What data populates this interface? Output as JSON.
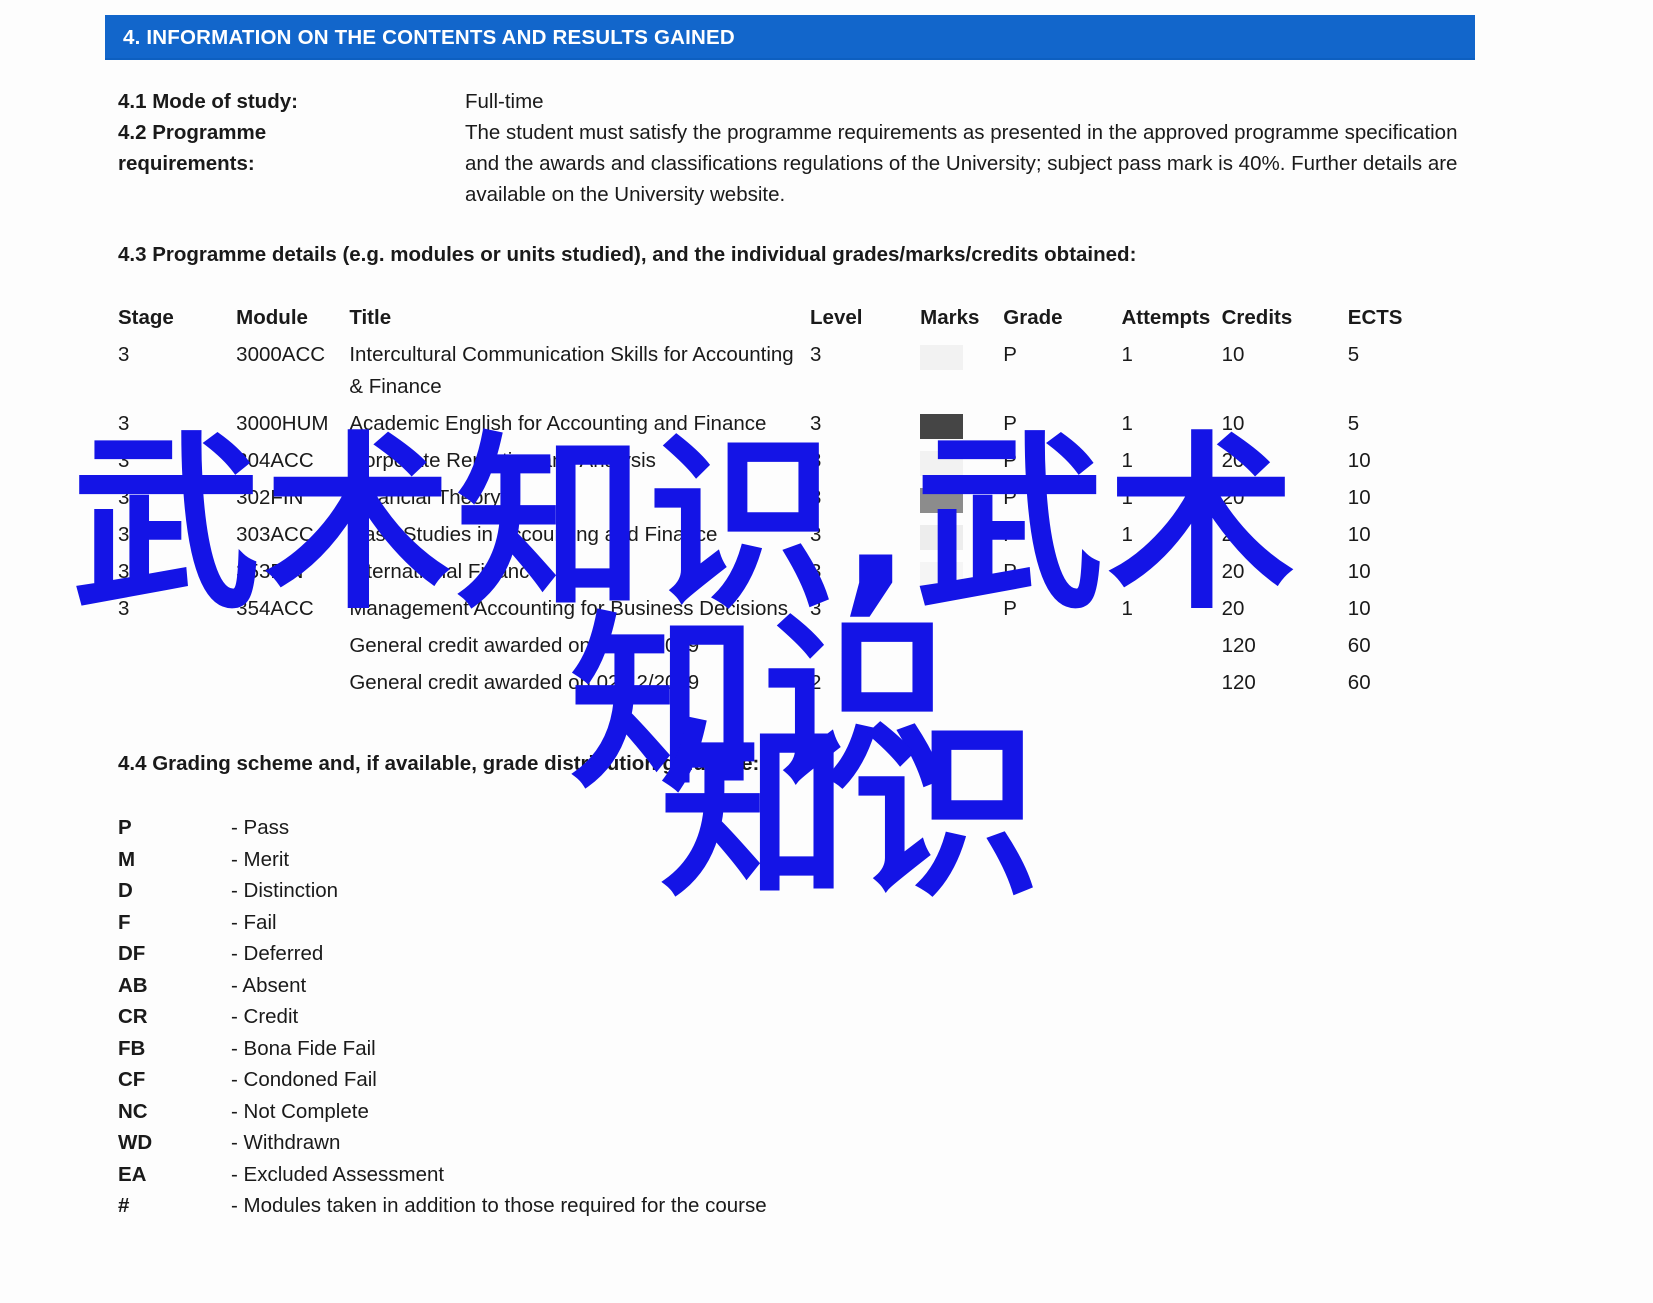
{
  "section": {
    "banner_title": "4. INFORMATION ON THE CONTENTS AND RESULTS GAINED",
    "banner_color": "#1266cb"
  },
  "fields": {
    "mode_of_study_label": "4.1 Mode of study:",
    "mode_of_study_value": "Full-time",
    "programme_requirements_label_line1": "4.2 Programme",
    "programme_requirements_label_line2": "requirements:",
    "programme_requirements_value": "The student must satisfy the programme requirements as presented in the approved programme specification and the awards and classifications regulations of the University; subject pass mark is 40%. Further details are available on the University website."
  },
  "programme_details": {
    "heading": "4.3 Programme details (e.g. modules or units studied), and the individual grades/marks/credits obtained:",
    "columns": [
      "Stage",
      "Module",
      "Title",
      "Level",
      "Marks",
      "Grade",
      "Attempts",
      "Credits",
      "ECTS"
    ],
    "rows": [
      {
        "stage": "3",
        "module": "3000ACC",
        "title": "Intercultural Communication Skills for Accounting & Finance",
        "level": "3",
        "marks": "",
        "marks_redaction": "#f2f2f2",
        "grade": "P",
        "attempts": "1",
        "credits": "10",
        "ects": "5"
      },
      {
        "stage": "3",
        "module": "3000HUM",
        "title": "Academic English for Accounting and Finance",
        "level": "3",
        "marks": "",
        "marks_redaction": "#454545",
        "grade": "P",
        "attempts": "1",
        "credits": "10",
        "ects": "5"
      },
      {
        "stage": "3",
        "module": "304ACC",
        "title": "Corporate Reporting and Analysis",
        "level": "3",
        "marks": "",
        "marks_redaction": "#f2f2f2",
        "grade": "P",
        "attempts": "1",
        "credits": "20",
        "ects": "10"
      },
      {
        "stage": "3",
        "module": "302FIN",
        "title": "Financial Theory",
        "level": "3",
        "marks": "",
        "marks_redaction": "#8c8c8c",
        "grade": "P",
        "attempts": "1",
        "credits": "20",
        "ects": "10"
      },
      {
        "stage": "3",
        "module": "303ACC",
        "title": "Case Studies in Accounting and Finance",
        "level": "3",
        "marks": "",
        "marks_redaction": "#ededed",
        "grade": "P",
        "attempts": "1",
        "credits": "20",
        "ects": "10"
      },
      {
        "stage": "3",
        "module": "353FIN",
        "title": "International Finance",
        "level": "3",
        "marks": "",
        "marks_redaction": "#f5f5f5",
        "grade": "P",
        "attempts": "1",
        "credits": "20",
        "ects": "10"
      },
      {
        "stage": "3",
        "module": "354ACC",
        "title": "Management Accounting for Business Decisions",
        "level": "3",
        "marks": "",
        "marks_redaction": "",
        "grade": "P",
        "attempts": "1",
        "credits": "20",
        "ects": "10"
      },
      {
        "stage": "",
        "module": "",
        "title": "General credit awarded on 02/12/2019",
        "level": "",
        "marks": "",
        "marks_redaction": "",
        "grade": "",
        "attempts": "",
        "credits": "120",
        "ects": "60"
      },
      {
        "stage": "",
        "module": "",
        "title": "General credit awarded on 02/12/2019",
        "level": "2",
        "marks": "",
        "marks_redaction": "",
        "grade": "",
        "attempts": "",
        "credits": "120",
        "ects": "60"
      }
    ]
  },
  "grading_scheme": {
    "heading": "4.4 Grading scheme and, if available, grade distribution guidance:",
    "entries": [
      {
        "code": "P",
        "desc": "- Pass"
      },
      {
        "code": "M",
        "desc": "- Merit"
      },
      {
        "code": "D",
        "desc": "- Distinction"
      },
      {
        "code": "F",
        "desc": "- Fail"
      },
      {
        "code": "DF",
        "desc": "- Deferred"
      },
      {
        "code": "AB",
        "desc": "- Absent"
      },
      {
        "code": "CR",
        "desc": "- Credit"
      },
      {
        "code": "FB",
        "desc": "- Bona Fide Fail"
      },
      {
        "code": "CF",
        "desc": "- Condoned Fail"
      },
      {
        "code": "NC",
        "desc": "- Not Complete"
      },
      {
        "code": "WD",
        "desc": "- Withdrawn"
      },
      {
        "code": "EA",
        "desc": "- Excluded Assessment"
      },
      {
        "code": "#",
        "desc": "- Modules taken in addition to those required for the course"
      }
    ]
  },
  "watermark": {
    "color": "#1414e6",
    "line1": "武术知识,武术",
    "line2": "知识",
    "line3": "知识"
  }
}
